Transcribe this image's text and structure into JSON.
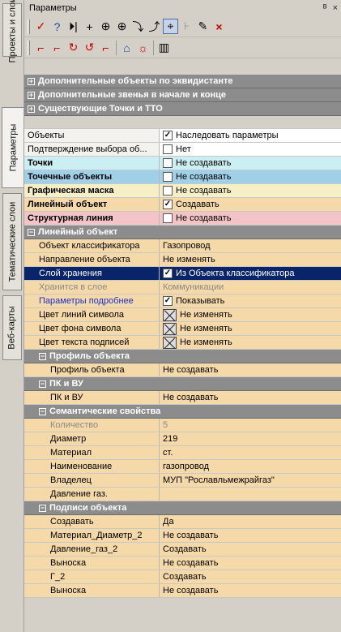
{
  "vtabs": [
    "Проекты и слои",
    "Параметры",
    "Тематические слои",
    "Веб-карты"
  ],
  "panel": {
    "title": "Параметры",
    "controls": "ᴮ ×"
  },
  "toolbar1": [
    "✓",
    "?",
    "⏵|",
    "+",
    "⊕",
    "⊕",
    "⤵",
    "⤴",
    "⌖",
    "⊦",
    "✎",
    "×"
  ],
  "toolbar2": [
    "⌐",
    "⌐",
    "↻",
    "↺",
    "⌐",
    "⌂",
    "☼",
    "▥"
  ],
  "colors": {
    "section": "#8c8c8c",
    "selected": "#0a246a",
    "cream": "#f5d9a8",
    "light": "#fbeedd"
  },
  "rows": [
    {
      "kind": "section",
      "text": "Дополнительные объекты по эквидистанте",
      "pm": "+"
    },
    {
      "kind": "section",
      "text": "Дополнительные звенья в начале и конце",
      "pm": "+"
    },
    {
      "kind": "section",
      "text": "Существующие Точки и ТТО",
      "pm": "+"
    },
    {
      "kind": "blank"
    },
    {
      "kind": "row",
      "name": "Объекты",
      "value": "Наследовать параметры",
      "cb": "✓",
      "bg": "#f4f2ee",
      "vbg": "#ffffff"
    },
    {
      "kind": "row",
      "name": "Подтверждение выбора об...",
      "value": "Нет",
      "cb": " ",
      "bg": "#f4f2ee",
      "vbg": "#ffffff"
    },
    {
      "kind": "row",
      "name": "Точки",
      "value": "Не создавать",
      "cb": " ",
      "bg": "#cbeef2",
      "vbg": "#cbeef2",
      "bold": true
    },
    {
      "kind": "row",
      "name": "Точечные объекты",
      "value": "Не создавать",
      "cb": " ",
      "bg": "#9fd0e8",
      "vbg": "#9fd0e8",
      "bold": true
    },
    {
      "kind": "row",
      "name": "Графическая маска",
      "value": "Не создавать",
      "cb": " ",
      "bg": "#f6efc6",
      "vbg": "#f6efc6",
      "bold": true
    },
    {
      "kind": "row",
      "name": "Линейный объект",
      "value": "Создавать",
      "cb": "✓",
      "bg": "#f5d9a8",
      "vbg": "#f5d9a8",
      "bold": true
    },
    {
      "kind": "row",
      "name": "Структурная линия",
      "value": "Не создавать",
      "cb": " ",
      "bg": "#f2c4c8",
      "vbg": "#f2c4c8",
      "bold": true
    },
    {
      "kind": "section",
      "text": "Линейный объект",
      "pm": "−"
    },
    {
      "kind": "row",
      "indent": 14,
      "name": "Объект классификатора",
      "value": "Газопровод",
      "bg": "#f5d9a8",
      "vbg": "#f5d9a8"
    },
    {
      "kind": "row",
      "indent": 14,
      "name": "Направление объекта",
      "value": "Не изменять",
      "bg": "#f5d9a8",
      "vbg": "#f5d9a8"
    },
    {
      "kind": "row",
      "indent": 14,
      "name": "Слой хранения",
      "value": "Из Объекта классификатора",
      "cb": "✓",
      "bg": "#0a246a",
      "vbg": "#0a246a",
      "fg": "#ffffff"
    },
    {
      "kind": "row",
      "indent": 14,
      "name": "Хранится в слое",
      "value": "Коммуникации",
      "bg": "#f5d9a8",
      "vbg": "#f5d9a8",
      "fg": "#8a8a8a"
    },
    {
      "kind": "row",
      "indent": 14,
      "name": "Параметры подробнее",
      "value": "Показывать",
      "cb": "✓",
      "bg": "#f5d9a8",
      "vbg": "#f5d9a8",
      "nfg": "#1a2ecc"
    },
    {
      "kind": "row",
      "indent": 14,
      "name": "Цвет линий символа",
      "value": "Не изменять",
      "xbox": true,
      "bg": "#f5d9a8",
      "vbg": "#f5d9a8"
    },
    {
      "kind": "row",
      "indent": 14,
      "name": "Цвет фона символа",
      "value": "Не изменять",
      "xbox": true,
      "bg": "#f5d9a8",
      "vbg": "#f5d9a8"
    },
    {
      "kind": "row",
      "indent": 14,
      "name": "Цвет текста подписей",
      "value": "Не изменять",
      "xbox": true,
      "bg": "#f5d9a8",
      "vbg": "#f5d9a8"
    },
    {
      "kind": "section",
      "text": "Профиль объекта",
      "pm": "−",
      "indent": 14
    },
    {
      "kind": "row",
      "indent": 28,
      "name": "Профиль объекта",
      "value": "Не создавать",
      "bg": "#f5d9a8",
      "vbg": "#f5d9a8"
    },
    {
      "kind": "section",
      "text": "ПК и ВУ",
      "pm": "−",
      "indent": 14
    },
    {
      "kind": "row",
      "indent": 28,
      "name": "ПК и ВУ",
      "value": "Не создавать",
      "bg": "#f5d9a8",
      "vbg": "#f5d9a8"
    },
    {
      "kind": "section",
      "text": "Семантические свойства",
      "pm": "−",
      "indent": 14
    },
    {
      "kind": "row",
      "indent": 28,
      "name": "Количество",
      "value": "5",
      "bg": "#f5d9a8",
      "vbg": "#f5d9a8",
      "fg": "#8a8a8a",
      "nfg": "#8a8a8a"
    },
    {
      "kind": "row",
      "indent": 28,
      "name": "Диаметр",
      "value": "219",
      "bg": "#f5d9a8",
      "vbg": "#f5d9a8"
    },
    {
      "kind": "row",
      "indent": 28,
      "name": "Материал",
      "value": "ст.",
      "bg": "#f5d9a8",
      "vbg": "#f5d9a8"
    },
    {
      "kind": "row",
      "indent": 28,
      "name": "Наименование",
      "value": "газопровод",
      "bg": "#f5d9a8",
      "vbg": "#f5d9a8"
    },
    {
      "kind": "row",
      "indent": 28,
      "name": "Владелец",
      "value": "МУП \"Рославльмежрайгаз\"",
      "bg": "#f5d9a8",
      "vbg": "#f5d9a8"
    },
    {
      "kind": "row",
      "indent": 28,
      "name": "Давление газ.",
      "value": "",
      "bg": "#f5d9a8",
      "vbg": "#f5d9a8"
    },
    {
      "kind": "section",
      "text": "Подписи объекта",
      "pm": "−",
      "indent": 14
    },
    {
      "kind": "row",
      "indent": 28,
      "name": "Создавать",
      "value": "Да",
      "bg": "#f5d9a8",
      "vbg": "#f5d9a8"
    },
    {
      "kind": "row",
      "indent": 28,
      "name": "Материал_Диаметр_2",
      "value": "Не создавать",
      "bg": "#f5d9a8",
      "vbg": "#f5d9a8"
    },
    {
      "kind": "row",
      "indent": 28,
      "name": "Давление_газ_2",
      "value": "Создавать",
      "bg": "#f5d9a8",
      "vbg": "#f5d9a8"
    },
    {
      "kind": "row",
      "indent": 28,
      "name": "Выноска",
      "value": "Не создавать",
      "bg": "#f5d9a8",
      "vbg": "#f5d9a8"
    },
    {
      "kind": "row",
      "indent": 28,
      "name": "Г_2",
      "value": "Создавать",
      "bg": "#f5d9a8",
      "vbg": "#f5d9a8"
    },
    {
      "kind": "row",
      "indent": 28,
      "name": "Выноска",
      "value": "Не создавать",
      "bg": "#f5d9a8",
      "vbg": "#f5d9a8"
    }
  ]
}
